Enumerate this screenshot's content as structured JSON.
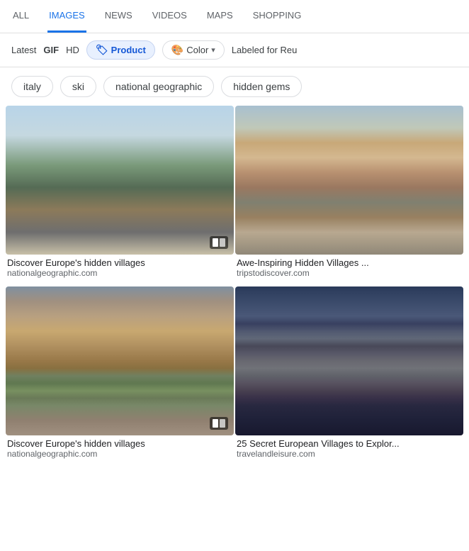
{
  "nav": {
    "tabs": [
      {
        "id": "all",
        "label": "ALL",
        "active": false
      },
      {
        "id": "images",
        "label": "IMAGES",
        "active": true
      },
      {
        "id": "news",
        "label": "NEWS",
        "active": false
      },
      {
        "id": "videos",
        "label": "VIDEOS",
        "active": false
      },
      {
        "id": "maps",
        "label": "MAPS",
        "active": false
      },
      {
        "id": "shopping",
        "label": "SHOPPING",
        "active": false
      }
    ]
  },
  "filters": {
    "items": [
      {
        "id": "latest",
        "label": "Latest",
        "style": "plain"
      },
      {
        "id": "gif",
        "label": "GIF",
        "style": "bold"
      },
      {
        "id": "hd",
        "label": "HD",
        "style": "plain"
      },
      {
        "id": "product",
        "label": "Product",
        "style": "active",
        "icon": "🏷"
      },
      {
        "id": "color",
        "label": "Color",
        "style": "outlined",
        "icon": "🎨",
        "hasChevron": true
      },
      {
        "id": "labeled",
        "label": "Labeled for Reu",
        "style": "plain"
      }
    ]
  },
  "chips": [
    {
      "id": "italy",
      "label": "italy"
    },
    {
      "id": "ski",
      "label": "ski"
    },
    {
      "id": "national-geographic",
      "label": "national geographic"
    },
    {
      "id": "hidden-gems",
      "label": "hidden gems"
    }
  ],
  "images": [
    {
      "id": "img1",
      "title": "Discover Europe's hidden villages",
      "source": "nationalgeographic.com",
      "style": "img-castle",
      "hasSlider": true
    },
    {
      "id": "img2",
      "title": "Awe-Inspiring Hidden Villages ...",
      "source": "tripstodiscover.com",
      "style": "img-village-day",
      "hasSlider": false
    },
    {
      "id": "img3",
      "title": "Discover Europe's hidden villages",
      "source": "nationalgeographic.com",
      "style": "img-alley",
      "hasSlider": true
    },
    {
      "id": "img4",
      "title": "25 Secret European Villages to Explor...",
      "source": "travelandleisure.com",
      "style": "img-night-village",
      "hasSlider": false
    }
  ],
  "slideIndicator": {
    "dots": [
      "",
      ""
    ]
  }
}
